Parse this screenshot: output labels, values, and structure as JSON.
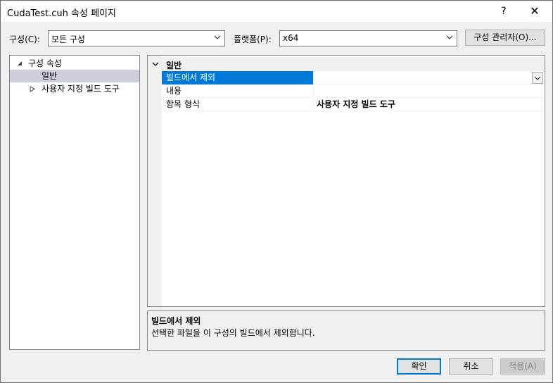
{
  "window": {
    "title": "CudaTest.cuh 속성 페이지",
    "help_glyph": "?",
    "close_glyph": "✕"
  },
  "toolbar": {
    "config_label": "구성(C):",
    "config_value": "모든 구성",
    "platform_label": "플랫폼(P):",
    "platform_value": "x64",
    "config_manager_label": "구성 관리자(O)..."
  },
  "tree": {
    "root_label": "구성 속성",
    "items": [
      {
        "label": "일반",
        "selected": true
      },
      {
        "label": "사용자 지정 빌드 도구",
        "selected": false
      }
    ]
  },
  "grid": {
    "category": "일반",
    "properties": [
      {
        "name": "빌드에서 제외",
        "value": "",
        "selected": true
      },
      {
        "name": "내용",
        "value": ""
      },
      {
        "name": "항목 형식",
        "value": "사용자 지정 빌드 도구"
      }
    ]
  },
  "description": {
    "title": "빌드에서 제외",
    "text": "선택한 파일을 이 구성의 빌드에서 제외합니다."
  },
  "buttons": {
    "ok": "확인",
    "cancel": "취소",
    "apply": "적용(A)"
  },
  "colors": {
    "selection": "#0078d7",
    "tree_selection": "#cccedb",
    "window_bg": "#f0f0f0"
  }
}
